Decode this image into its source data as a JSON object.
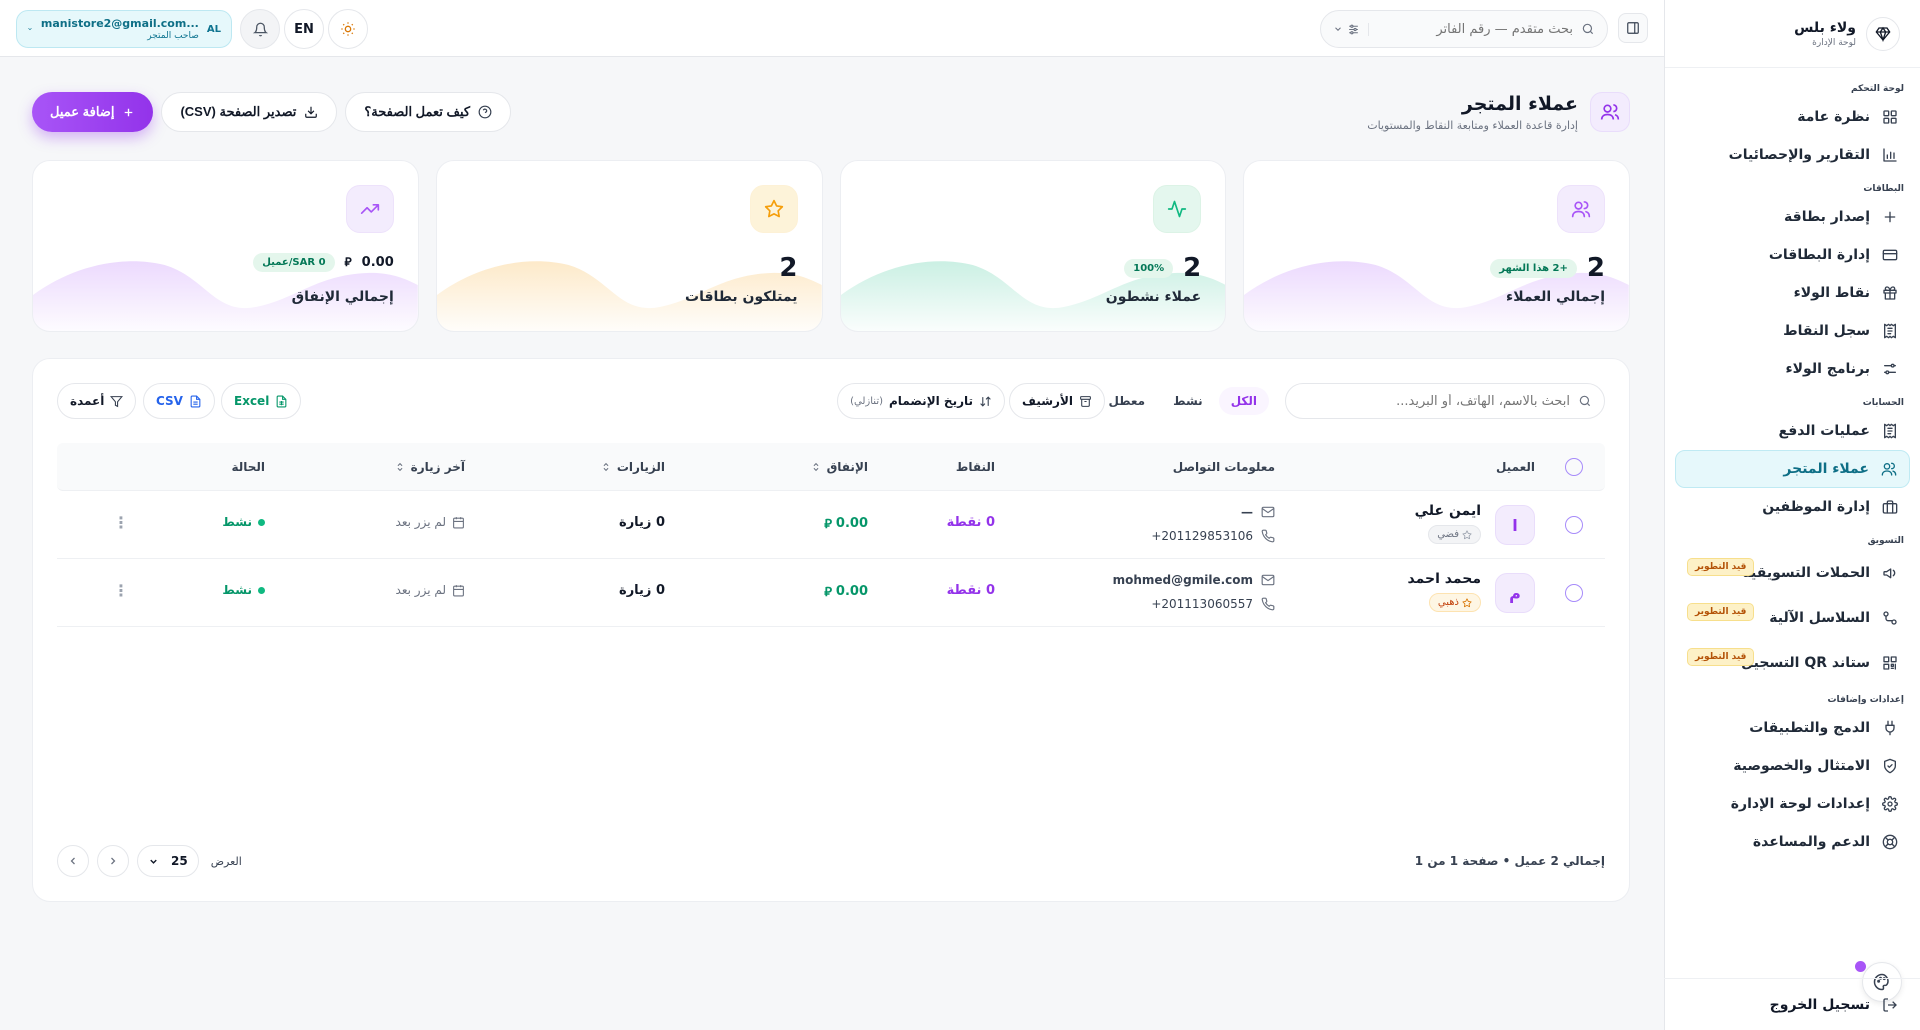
{
  "brand": {
    "name": "ولاء بلس",
    "subtitle": "لوحة الإدارة"
  },
  "sidebar": {
    "sections": [
      {
        "title": "لوحة التحكم",
        "items": [
          {
            "label": "نظرة عامة",
            "icon": "grid-icon"
          },
          {
            "label": "التقارير والإحصائيات",
            "icon": "bar-chart-icon"
          }
        ]
      },
      {
        "title": "البطاقات",
        "items": [
          {
            "label": "إصدار بطاقة",
            "icon": "plus-icon"
          },
          {
            "label": "إدارة البطاقات",
            "icon": "card-icon"
          },
          {
            "label": "نقاط الولاء",
            "icon": "gift-icon"
          },
          {
            "label": "سجل النقاط",
            "icon": "receipt-icon"
          },
          {
            "label": "برنامج الولاء",
            "icon": "sliders-icon"
          }
        ]
      },
      {
        "title": "الحسابات",
        "items": [
          {
            "label": "عمليات الدفع",
            "icon": "receipt-icon"
          },
          {
            "label": "عملاء المتجر",
            "icon": "users-icon",
            "active": true
          },
          {
            "label": "إدارة الموظفين",
            "icon": "briefcase-icon"
          }
        ]
      },
      {
        "title": "التسويق",
        "items": [
          {
            "label": "الحملات التسويقية",
            "icon": "megaphone-icon",
            "badge": "قيد التطوير"
          },
          {
            "label": "السلاسل الآلية",
            "icon": "workflow-icon",
            "badge": "قيد التطوير"
          },
          {
            "label": "ستاند QR التسجيل",
            "icon": "qr-icon",
            "badge": "قيد التطوير"
          }
        ]
      },
      {
        "title": "إعدادات وإضافات",
        "items": [
          {
            "label": "الدمج والتطبيقات",
            "icon": "plug-icon"
          },
          {
            "label": "الامتثال والخصوصية",
            "icon": "shield-icon"
          },
          {
            "label": "إعدادات لوحة الإدارة",
            "icon": "gear-icon"
          },
          {
            "label": "الدعم والمساعدة",
            "icon": "lifebuoy-icon"
          }
        ]
      }
    ],
    "logout": "تسجيل الخروج"
  },
  "topbar": {
    "search_placeholder": "بحث متقدم — رقم الفاتر",
    "lang": "EN",
    "account": {
      "initials": "AL",
      "email": "manistore2@gmail.com...",
      "role": "صاحب المتجر"
    }
  },
  "header": {
    "title": "عملاء المتجر",
    "subtitle": "إدارة قاعدة العملاء ومتابعة النقاط والمستويات",
    "how_label": "كيف تعمل الصفحة؟",
    "export_label": "تصدير الصفحة (CSV)",
    "add_label": "إضافة عميل"
  },
  "stats": [
    {
      "value": "2",
      "pill": "+2 هذا الشهر",
      "label": "إجمالي العملاء",
      "color": "#a855f7",
      "icon": "users-icon"
    },
    {
      "value": "2",
      "pill": "100%",
      "label": "عملاء نشطون",
      "color": "#10b981",
      "icon": "activity-icon"
    },
    {
      "value": "2",
      "pill": "",
      "label": "يمتلكون بطاقات",
      "color": "#f59e0b",
      "icon": "star-icon"
    },
    {
      "value": "0.00",
      "pill": "0 SAR/عميل",
      "label": "إجمالي الإنفاق",
      "color": "#a855f7",
      "icon": "trending-up-icon"
    }
  ],
  "table": {
    "search_placeholder": "ابحث بالاسم، الهاتف، أو البريد...",
    "filters": [
      "الكل",
      "نشط",
      "معطل"
    ],
    "archive_label": "الأرشيف",
    "sort_label": "تاريخ الإنضمام",
    "sort_dir": "(تنازلي)",
    "excel_label": "Excel",
    "csv_label": "CSV",
    "columns_label": "أعمدة",
    "headers": {
      "customer": "العميل",
      "contact": "معلومات التواصل",
      "points": "النقاط",
      "spend": "الإنفاق",
      "visits": "الزيارات",
      "last_visit": "آخر زيارة",
      "status": "الحالة"
    },
    "rows": [
      {
        "initial": "ا",
        "name": "ايمن علي",
        "tier": "فضي",
        "email": "—",
        "phone": "+201129853106",
        "points": "0 نقطة",
        "spend": "0.00",
        "visits": "0 زيارة",
        "last_visit": "لم يزر بعد",
        "status": "نشط"
      },
      {
        "initial": "م",
        "name": "محمد احمد",
        "tier": "ذهبي",
        "email": "mohmed@gmile.com",
        "phone": "+201113060557",
        "points": "0 نقطة",
        "spend": "0.00",
        "visits": "0 زيارة",
        "last_visit": "لم يزر بعد",
        "status": "نشط"
      }
    ],
    "footer_total": "إجمالي 2 عميل • صفحة 1 من 1",
    "page_size_label": "العرض",
    "page_size": "25"
  }
}
